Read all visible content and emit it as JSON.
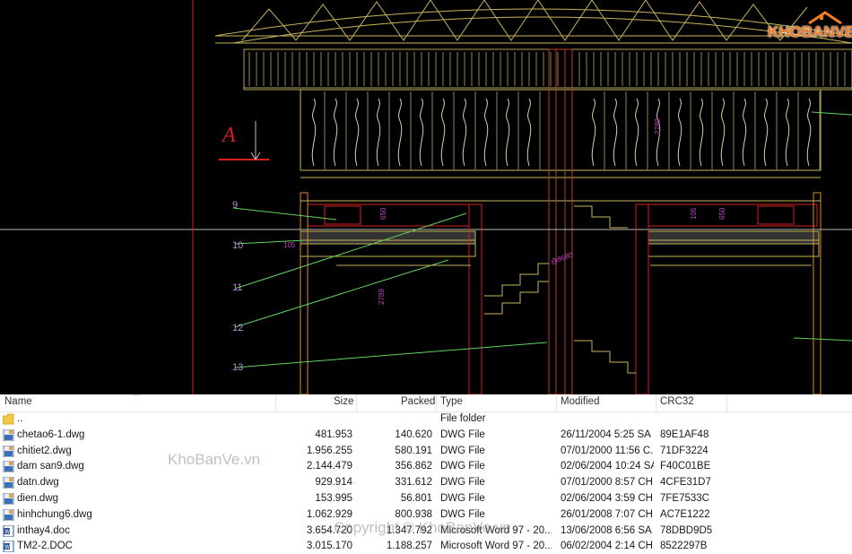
{
  "drawing": {
    "section_mark": "A",
    "callouts": [
      "9",
      "10",
      "11",
      "12",
      "13"
    ],
    "dims": [
      "2789",
      "2789",
      "@8680",
      "650",
      "650",
      "105",
      "105"
    ]
  },
  "logo": {
    "text": "KHOBANVE"
  },
  "watermarks": {
    "main": "KhoBanVe.vn",
    "copyright": "Copyright © KhoBanVe.vn"
  },
  "columns": {
    "name": "Name",
    "size": "Size",
    "packed": "Packed",
    "type": "Type",
    "modified": "Modified",
    "crc": "CRC32"
  },
  "files": [
    {
      "name": "..",
      "size": "",
      "packed": "",
      "type": "File folder",
      "modified": "",
      "crc": "",
      "icon": "folder-icon"
    },
    {
      "name": "chetao6-1.dwg",
      "size": "481.953",
      "packed": "140.620",
      "type": "DWG File",
      "modified": "26/11/2004 5:25 SA",
      "crc": "89E1AF48",
      "icon": "dwg-file-icon"
    },
    {
      "name": "chitiet2.dwg",
      "size": "1.956.255",
      "packed": "580.191",
      "type": "DWG File",
      "modified": "07/01/2000 11:56 C...",
      "crc": "71DF3224",
      "icon": "dwg-file-icon"
    },
    {
      "name": "dam san9.dwg",
      "size": "2.144.479",
      "packed": "356.862",
      "type": "DWG File",
      "modified": "02/06/2004 10:24 SA",
      "crc": "F40C01BE",
      "icon": "dwg-file-icon"
    },
    {
      "name": "datn.dwg",
      "size": "929.914",
      "packed": "331.612",
      "type": "DWG File",
      "modified": "07/01/2000 8:57 CH",
      "crc": "4CFE31D7",
      "icon": "dwg-file-icon"
    },
    {
      "name": "dien.dwg",
      "size": "153.995",
      "packed": "56.801",
      "type": "DWG File",
      "modified": "02/06/2004 3:59 CH",
      "crc": "7FE7533C",
      "icon": "dwg-file-icon"
    },
    {
      "name": "hinhchung6.dwg",
      "size": "1.062.929",
      "packed": "800.938",
      "type": "DWG File",
      "modified": "26/01/2008 7:07 CH",
      "crc": "AC7E1222",
      "icon": "dwg-file-icon"
    },
    {
      "name": "inthay4.doc",
      "size": "3.654.720",
      "packed": "1.347.792",
      "type": "Microsoft Word 97 - 20...",
      "modified": "13/06/2008 6:56 SA",
      "crc": "78DBD9D5",
      "icon": "word-doc-icon"
    },
    {
      "name": "TM2-2.DOC",
      "size": "3.015.170",
      "packed": "1.188.257",
      "type": "Microsoft Word 97 - 20...",
      "modified": "06/02/2004 2:14 CH",
      "crc": "8522297B",
      "icon": "word-doc-icon"
    }
  ],
  "colors": {
    "cad_bg": "#000000",
    "cad_yellow": "#c9b45a",
    "cad_red": "#d42020",
    "cad_green": "#5fd35f",
    "cad_magenta": "#c040c0",
    "logo_orange": "#f47b20"
  }
}
